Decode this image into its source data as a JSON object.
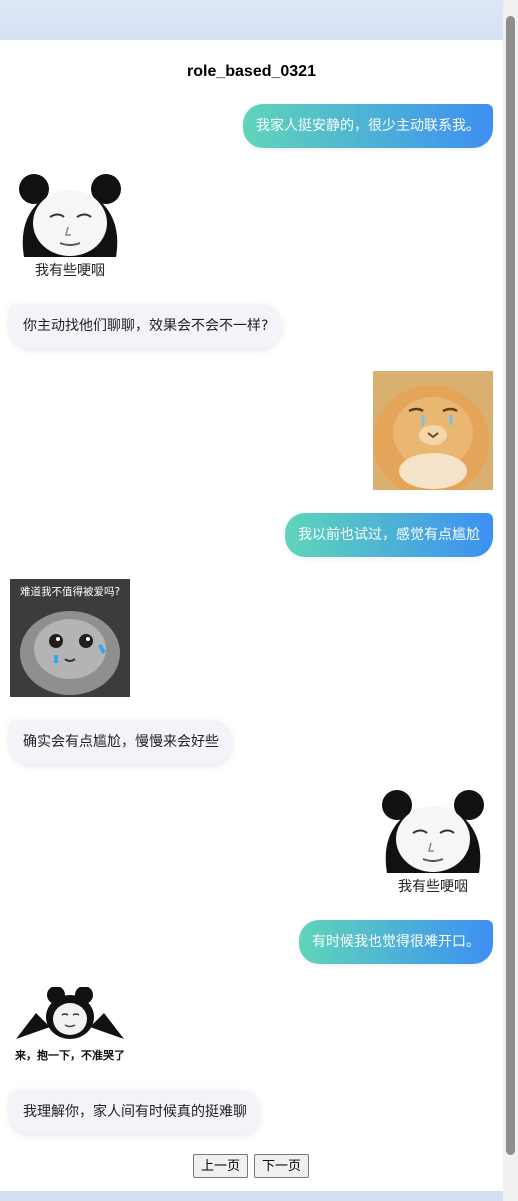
{
  "title": "role_based_0321",
  "messages": {
    "m1": "我家人挺安静的，很少主动联系我。",
    "m2": "你主动找他们聊聊，效果会不会不一样?",
    "m3": "我以前也试过，感觉有点尴尬",
    "m4": "确实会有点尴尬，慢慢来会好些",
    "m5": "有时候我也觉得很难开口。",
    "m6": "我理解你，家人间有时候真的挺难聊"
  },
  "stickers": {
    "panda_caption": "我有些哽咽",
    "cat_caption": "难道我不值得被爱吗?",
    "hug_caption": "来，抱一下，不准哭了"
  },
  "pager": {
    "prev": "上一页",
    "next": "下一页"
  },
  "colors": {
    "user_gradient_start": "#5fd5b9",
    "user_gradient_end": "#3d8ff2",
    "bot_bubble": "#f2f4f9"
  }
}
